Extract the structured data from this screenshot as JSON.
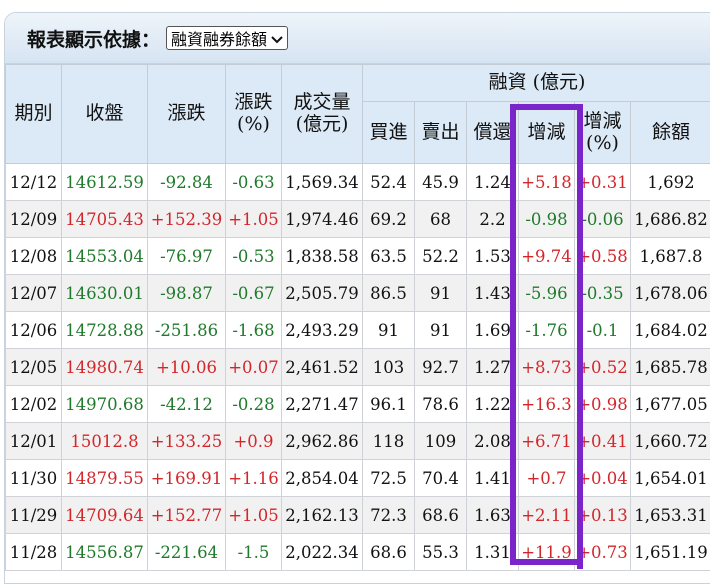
{
  "report_label": "報表顯示依據：",
  "report_select": {
    "value": "融資融券餘額",
    "icon": "chevron-down-icon"
  },
  "headers": {
    "date": "期別",
    "close": "收盤",
    "change": "漲跌",
    "change_pct": "漲跌(%)",
    "volume": "成交量(億元)",
    "margin_group": "融資 (億元)",
    "buy": "買進",
    "sell": "賣出",
    "repay": "償還",
    "net": "增減",
    "net_pct": "增減(%)",
    "balance": "餘額"
  },
  "colors": {
    "up": "#d3262b",
    "down": "#1f7a2b",
    "highlight": "#7b24c9"
  },
  "rows": [
    [
      "12/12",
      "14612.59",
      "-92.84",
      "-0.63",
      "1,569.34",
      "52.4",
      "45.9",
      "1.24",
      "+5.18",
      "+0.31",
      "1,692"
    ],
    [
      "12/09",
      "14705.43",
      "+152.39",
      "+1.05",
      "1,974.46",
      "69.2",
      "68",
      "2.2",
      "-0.98",
      "-0.06",
      "1,686.82"
    ],
    [
      "12/08",
      "14553.04",
      "-76.97",
      "-0.53",
      "1,838.58",
      "63.5",
      "52.2",
      "1.53",
      "+9.74",
      "+0.58",
      "1,687.8"
    ],
    [
      "12/07",
      "14630.01",
      "-98.87",
      "-0.67",
      "2,505.79",
      "86.5",
      "91",
      "1.43",
      "-5.96",
      "-0.35",
      "1,678.06"
    ],
    [
      "12/06",
      "14728.88",
      "-251.86",
      "-1.68",
      "2,493.29",
      "91",
      "91",
      "1.69",
      "-1.76",
      "-0.1",
      "1,684.02"
    ],
    [
      "12/05",
      "14980.74",
      "+10.06",
      "+0.07",
      "2,461.52",
      "103",
      "92.7",
      "1.27",
      "+8.73",
      "+0.52",
      "1,685.78"
    ],
    [
      "12/02",
      "14970.68",
      "-42.12",
      "-0.28",
      "2,271.47",
      "96.1",
      "78.6",
      "1.22",
      "+16.3",
      "+0.98",
      "1,677.05"
    ],
    [
      "12/01",
      "15012.8",
      "+133.25",
      "+0.9",
      "2,962.86",
      "118",
      "109",
      "2.08",
      "+6.71",
      "+0.41",
      "1,660.72"
    ],
    [
      "11/30",
      "14879.55",
      "+169.91",
      "+1.16",
      "2,854.04",
      "72.5",
      "70.4",
      "1.41",
      "+0.7",
      "+0.04",
      "1,654.01"
    ],
    [
      "11/29",
      "14709.64",
      "+152.77",
      "+1.05",
      "2,162.13",
      "72.3",
      "68.6",
      "1.63",
      "+2.11",
      "+0.13",
      "1,653.31"
    ],
    [
      "11/28",
      "14556.87",
      "-221.64",
      "-1.5",
      "2,022.34",
      "68.6",
      "55.3",
      "1.31",
      "+11.9",
      "+0.73",
      "1,651.19"
    ]
  ]
}
